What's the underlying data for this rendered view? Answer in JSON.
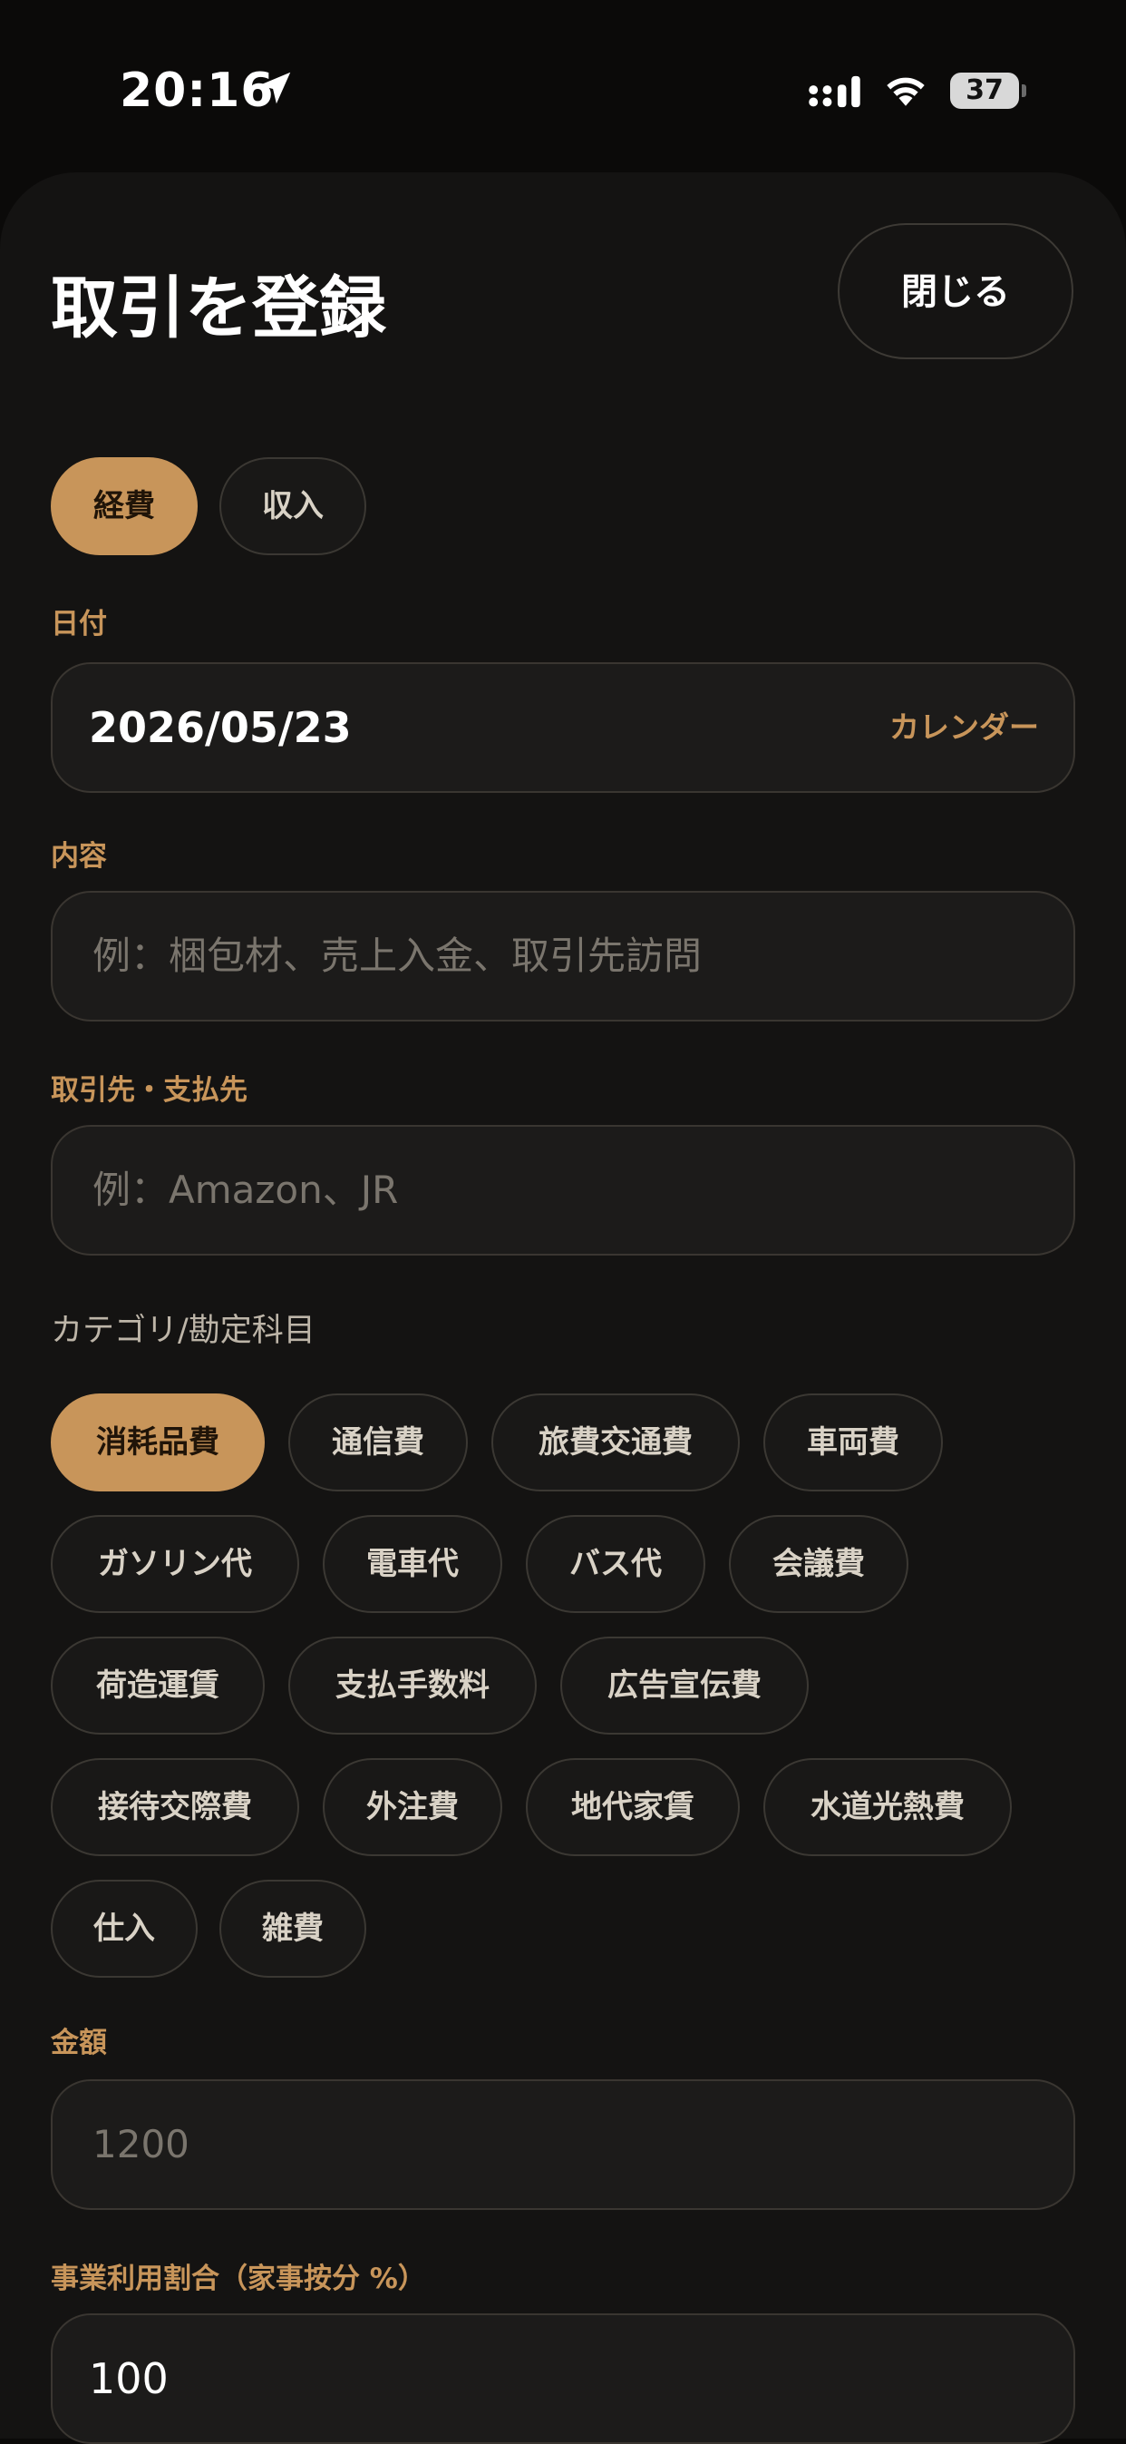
{
  "status_bar": {
    "time": "20:16",
    "battery": "37"
  },
  "header": {
    "title": "取引を登録",
    "close_label": "閉じる"
  },
  "type_toggle": [
    "経費",
    "収入"
  ],
  "date": {
    "label": "日付",
    "value": "2026/05/23",
    "calendar_label": "カレンダー"
  },
  "description": {
    "label": "内容",
    "placeholder": "例：梱包材、売上入金、取引先訪問"
  },
  "payee": {
    "label": "取引先・支払先",
    "placeholder": "例：Amazon、JR"
  },
  "category": {
    "label": "カテゴリ/勘定科目",
    "options": [
      "消耗品費",
      "通信費",
      "旅費交通費",
      "車両費",
      "ガソリン代",
      "電車代",
      "バス代",
      "会議費",
      "荷造運賃",
      "支払手数料",
      "広告宣伝費",
      "接待交際費",
      "外注費",
      "地代家賃",
      "水道光熱費",
      "仕入",
      "雑費"
    ],
    "selected": "消耗品費"
  },
  "amount": {
    "label": "金額",
    "placeholder": "1200"
  },
  "business_ratio": {
    "label": "事業利用割合（家事按分 %）",
    "value": "100"
  },
  "colors": {
    "accent": "#c8955a",
    "background": "#0b0a09",
    "sheet": "#141312",
    "field": "#1c1b1a"
  }
}
